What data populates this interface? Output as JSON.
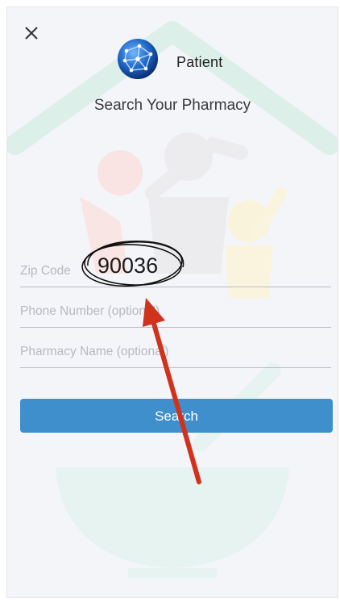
{
  "header": {
    "app_name": "Patient",
    "title": "Search Your Pharmacy",
    "close_icon": "close-icon",
    "logo_icon": "globe-network-logo"
  },
  "form": {
    "zip_label": "Zip Code",
    "zip_value": "90036",
    "phone_placeholder": "Phone Number (optional)",
    "pharmacy_placeholder": "Pharmacy Name (optional)"
  },
  "actions": {
    "search_label": "Search"
  },
  "colors": {
    "background": "#f4f5f9",
    "button": "#3f8fcc",
    "annotation_arrow": "#d0321c"
  }
}
